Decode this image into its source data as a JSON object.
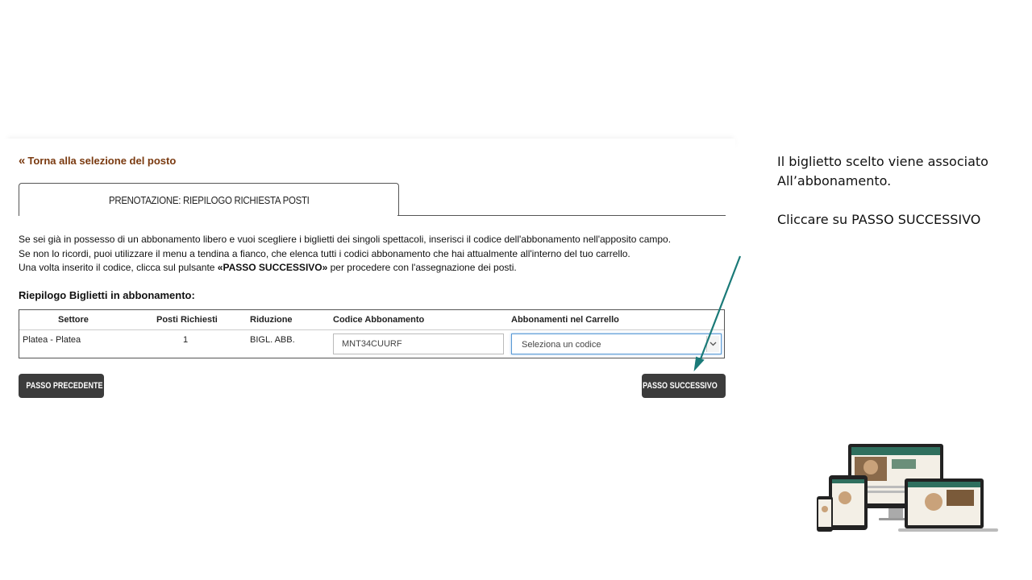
{
  "back_link": {
    "arrows": "«",
    "label": "Torna alla selezione del posto"
  },
  "tab": {
    "title": "PRENOTAZIONE: RIEPILOGO RICHIESTA POSTI"
  },
  "intro": {
    "line1": "Se sei già in possesso di un abbonamento libero e vuoi scegliere i biglietti dei singoli spettacoli, inserisci il codice dell'abbonamento nell'apposito campo.",
    "line2": "Se non lo ricordi, puoi utilizzare il menu a tendina a fianco, che elenca tutti i codici abbonamento che hai attualmente all'interno del tuo carrello.",
    "line3_pre": "Una volta inserito il codice, clicca sul pulsante ",
    "line3_bold": "«PASSO SUCCESSIVO»",
    "line3_post": " per procedere con l'assegnazione dei posti."
  },
  "summary": {
    "title": "Riepilogo Biglietti in abbonamento:",
    "headers": [
      "Settore",
      "Posti Richiesti",
      "Riduzione",
      "Codice Abbonamento",
      "Abbonamenti nel Carrello"
    ],
    "row": {
      "settore": "Platea - Platea",
      "posti": "1",
      "riduzione": "BIGL. ABB.",
      "codice_value": "MNT34CUURF",
      "carrello_selected": "Seleziona un codice"
    }
  },
  "buttons": {
    "prev_chev": "«",
    "prev_label": "PASSO PRECEDENTE",
    "next_label": "PASSO SUCCESSIVO",
    "next_chev": "»"
  },
  "callout": {
    "line1": "Il biglietto scelto viene associato",
    "line2": "All’abbonamento.",
    "line3": "Cliccare su PASSO SUCCESSIVO"
  },
  "colors": {
    "link": "#7a3a10",
    "button_bg": "#3c3c3c",
    "arrow": "#1a7a78",
    "select_focus": "#5a9ad6"
  },
  "icons": {
    "select_arrow": "chevron-down-icon",
    "devices": "responsive-devices-illustration"
  }
}
